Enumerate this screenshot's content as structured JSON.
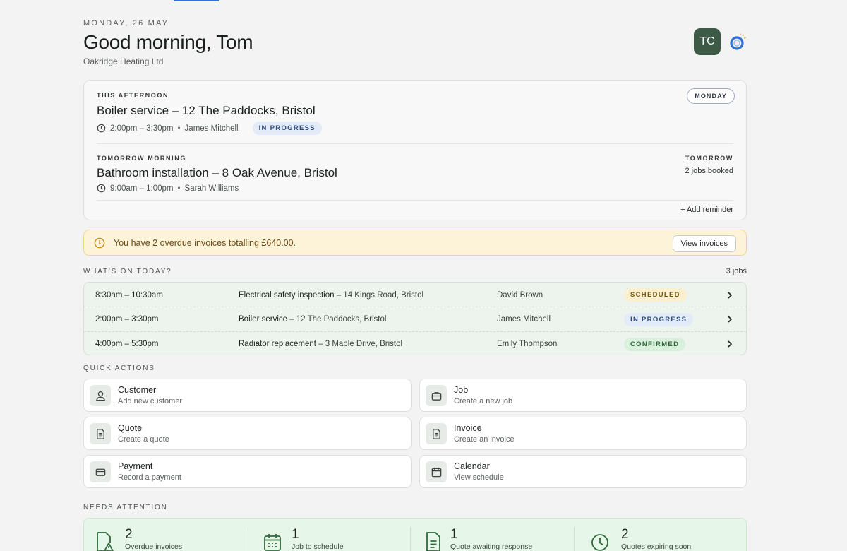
{
  "header": {
    "date": "MONDAY, 26 MAY",
    "greeting": "Good morning, Tom",
    "company": "Oakridge Heating Ltd",
    "avatar_initials": "TC",
    "assistant_icon": "assistant-ring-icon"
  },
  "schedule": {
    "day_badge": "MONDAY",
    "current": {
      "kicker": "THIS AFTERNOON",
      "title": "Boiler service – 12 The Paddocks, Bristol",
      "time": "2:00pm – 3:30pm",
      "person": "James Mitchell",
      "status": "IN PROGRESS"
    },
    "next": {
      "kicker": "TOMORROW MORNING",
      "title": "Bathroom installation – 8 Oak Avenue, Bristol",
      "time": "9:00am – 1:00pm",
      "person": "Sarah Williams",
      "side_label": "TOMORROW",
      "side_value": "2 jobs booked"
    },
    "add_reminder": "+ Add reminder"
  },
  "alert": {
    "text": "You have 2 overdue invoices totalling £640.00.",
    "button": "View invoices"
  },
  "today": {
    "label": "WHAT'S ON TODAY?",
    "count": "3 jobs",
    "jobs": [
      {
        "time": "8:30am – 10:30am",
        "job": "Electrical safety inspection",
        "address": " – 14 Kings Road, Bristol",
        "person": "David Brown",
        "status": "SCHEDULED"
      },
      {
        "time": "2:00pm – 3:30pm",
        "job": "Boiler service",
        "address": " – 12 The Paddocks, Bristol",
        "person": "James Mitchell",
        "status": "IN PROGRESS"
      },
      {
        "time": "4:00pm – 5:30pm",
        "job": "Radiator replacement",
        "address": " – 3 Maple Drive, Bristol",
        "person": "Emily Thompson",
        "status": "CONFIRMED"
      }
    ]
  },
  "quick_actions": {
    "label": "QUICK ACTIONS",
    "items": [
      {
        "title": "Customer",
        "subtitle": "Add new customer",
        "icon": "person-icon"
      },
      {
        "title": "Job",
        "subtitle": "Create a new job",
        "icon": "briefcase-icon"
      },
      {
        "title": "Quote",
        "subtitle": "Create a quote",
        "icon": "document-icon"
      },
      {
        "title": "Invoice",
        "subtitle": "Create an invoice",
        "icon": "invoice-icon"
      },
      {
        "title": "Payment",
        "subtitle": "Record a payment",
        "icon": "card-icon"
      },
      {
        "title": "Calendar",
        "subtitle": "View schedule",
        "icon": "calendar-icon"
      }
    ]
  },
  "needs_attention": {
    "label": "NEEDS ATTENTION",
    "items": [
      {
        "count": "2",
        "label": "Overdue invoices",
        "icon": "document-warning-icon"
      },
      {
        "count": "1",
        "label": "Job to schedule",
        "icon": "calendar-icon"
      },
      {
        "count": "1",
        "label": "Quote awaiting response",
        "icon": "document-icon"
      },
      {
        "count": "2",
        "label": "Quotes expiring soon",
        "icon": "clock-icon"
      }
    ]
  },
  "colors": {
    "accent": "#2f6fd6",
    "avatar_bg": "#3d5a47",
    "alert_bg": "#fdf3d8",
    "today_bg": "#edf4ed",
    "needs_bg": "#e6f6e8"
  }
}
